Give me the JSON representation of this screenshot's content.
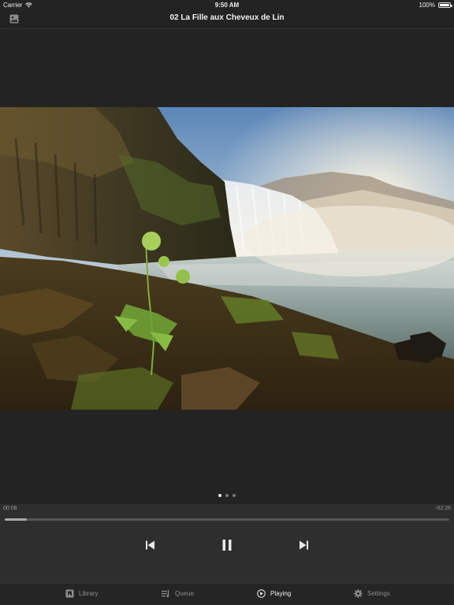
{
  "status_bar": {
    "carrier": "Carrier",
    "time": "9:50 AM",
    "battery": "100%"
  },
  "nav": {
    "title": "02 La Fille aux Cheveux de Lin",
    "left_icon": "photo-icon"
  },
  "artwork": {
    "subject": "waterfall-landscape"
  },
  "pager": {
    "pages": 3,
    "current": 1
  },
  "player": {
    "elapsed": "00:08",
    "remaining": "-02:26",
    "progress": 0.05,
    "controls": [
      "skip-back-icon",
      "pause-icon",
      "skip-forward-icon"
    ]
  },
  "tabs": [
    {
      "label": "Library",
      "icon": "library-icon",
      "active": false
    },
    {
      "label": "Queue",
      "icon": "queue-icon",
      "active": false
    },
    {
      "label": "Playing",
      "icon": "play-circle-icon",
      "active": true
    },
    {
      "label": "Settings",
      "icon": "gear-icon",
      "active": false
    }
  ],
  "colors": {
    "background": "#232323",
    "player_bg": "#2e2e2e",
    "active_tab": "#f0f0f0",
    "inactive_tab": "#8e8e8e"
  }
}
